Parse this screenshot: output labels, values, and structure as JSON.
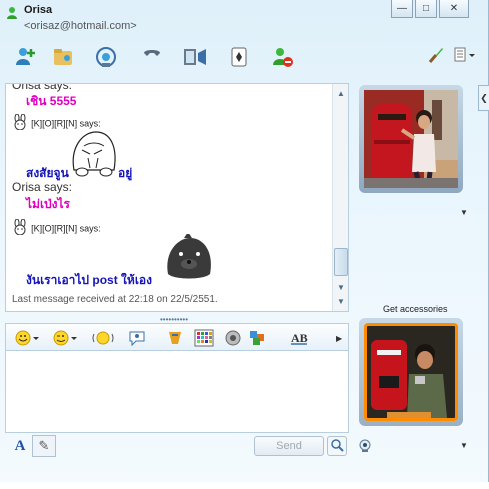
{
  "header": {
    "name": "Orisa",
    "email": "<orisaz@hotmail.com>"
  },
  "window_controls": {
    "minimize": "—",
    "maximize": "□",
    "close": "✕"
  },
  "toolbar": {
    "icons": [
      "invite-contact-icon",
      "share-files-icon",
      "video-call-icon",
      "call-icon",
      "activities-icon",
      "games-icon",
      "block-icon"
    ],
    "right_icons": [
      "paint-brush-icon",
      "menu-icon"
    ]
  },
  "conversation": {
    "partial_sender": "Orisa says:",
    "messages": [
      {
        "text": "เชิน 5555",
        "style": "pink"
      },
      {
        "sender": "[K][O][R][N] says:"
      },
      {
        "text": "สงสัยจูน",
        "suffix": "อยู่",
        "style": "blue"
      },
      {
        "sender_plain": "Orisa says:"
      },
      {
        "text": "ไม่เป่งไร",
        "style": "pink"
      },
      {
        "sender": "[K][O][R][N] says:"
      },
      {
        "text": "งันเราเอาไป post ให้เอง",
        "style": "blue"
      }
    ],
    "last_message": "Last message received at 22:18 on 22/5/2551."
  },
  "divider": "••••••••••",
  "compose": {
    "tools": [
      "emoticon-icon",
      "wink-icon",
      "nudge-icon",
      "voice-clip-icon",
      "character-icon",
      "background-icon",
      "handwriting-icon",
      "ink-color-icon",
      "font-icon"
    ],
    "input_value": ""
  },
  "bottom": {
    "send_label": "Send",
    "font_tab": "A",
    "handwriting_tab": "✎"
  },
  "side": {
    "get_accessories": "Get accessories"
  },
  "colors": {
    "pink_text": "#e000c0",
    "blue_text": "#1414b8",
    "pic_frame_top": "#6e8aa6",
    "pic_frame_bottom": "#ff8c00"
  }
}
